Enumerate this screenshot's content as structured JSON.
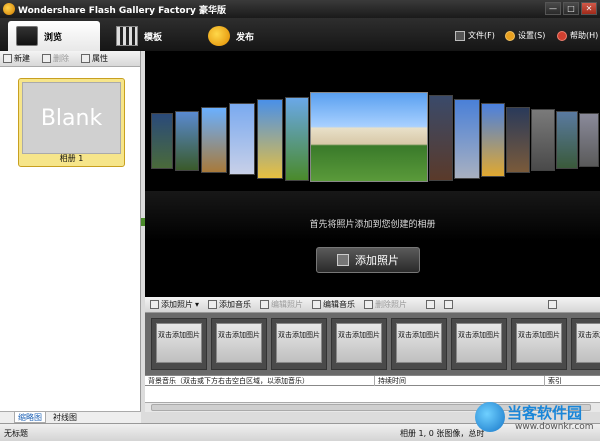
{
  "app": {
    "title": "Wondershare Flash Gallery Factory 豪华版"
  },
  "window_controls": {
    "minimize": "—",
    "maximize": "□",
    "close": "✕"
  },
  "tabs": [
    {
      "label": "浏览",
      "icon": "browse-icon",
      "active": true
    },
    {
      "label": "模板",
      "icon": "template-icon",
      "active": false
    },
    {
      "label": "发布",
      "icon": "publish-icon",
      "active": false
    }
  ],
  "top_menu": {
    "file": "文件(F)",
    "settings": "设置(S)",
    "help": "帮助(H)"
  },
  "album_toolbar": {
    "new": "新建",
    "delete": "删除",
    "properties": "属性"
  },
  "album": {
    "thumb_text": "Blank",
    "label": "相册 1"
  },
  "left_tabs": {
    "thumbnails": "缩略图",
    "lightbox": "衬线图"
  },
  "viewer": {
    "hint": "首先将照片添加到您创建的相册",
    "add_button": "添加照片"
  },
  "photo_toolbar": {
    "add_photo": "添加照片",
    "add_music": "添加音乐",
    "edit_photo": "编辑照片",
    "edit_music": "编辑音乐",
    "delete_photo": "删除照片"
  },
  "slots": {
    "label": "双击添加图片"
  },
  "music_columns": {
    "music": "背景音乐（双击或下方右击空白区域，以添加音乐）",
    "duration": "持续时间",
    "index": "索引"
  },
  "status": {
    "left": "无标题",
    "right": "相册 1, 0 张图像，总时"
  },
  "watermark": {
    "text": "当客软件园",
    "url": "www.downkr.com"
  },
  "colors": {
    "accent": "#1a86d8",
    "album_card": "#f6e58a",
    "viewer_bg": "#000000"
  }
}
